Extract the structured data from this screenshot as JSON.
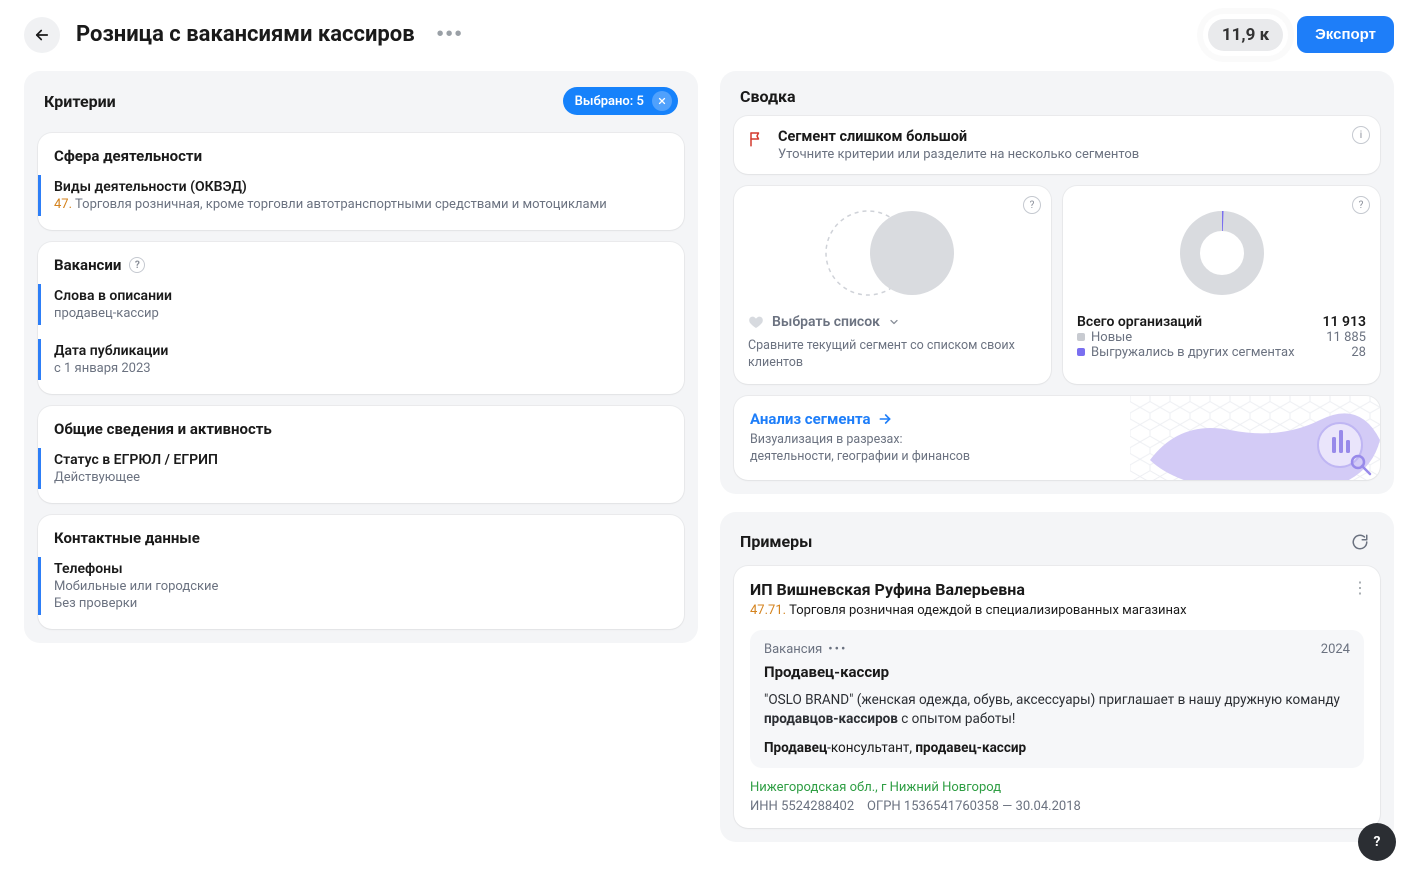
{
  "header": {
    "title": "Розница с вакансиями кассиров",
    "count_badge": "11,9 к",
    "export_label": "Экспорт"
  },
  "criteria": {
    "panel_title": "Критерии",
    "selected_chip": "Выбрано: 5",
    "groups": [
      {
        "title": "Сфера деятельности",
        "help": false,
        "items": [
          {
            "label": "Виды деятельности (ОКВЭД)",
            "code": "47.",
            "value": "Торговля розничная, кроме торговли автотранспортными средствами и мотоциклами"
          }
        ]
      },
      {
        "title": "Вакансии",
        "help": true,
        "items": [
          {
            "label": "Слова в описании",
            "value": "продавец-кассир"
          },
          {
            "label": "Дата публикации",
            "value": "с 1 января 2023"
          }
        ]
      },
      {
        "title": "Общие сведения и активность",
        "help": false,
        "items": [
          {
            "label": "Статус в ЕГРЮЛ / ЕГРИП",
            "value": "Действующее"
          }
        ]
      },
      {
        "title": "Контактные данные",
        "help": false,
        "items": [
          {
            "label": "Телефоны",
            "value": "Мобильные или городские",
            "value2": "Без проверки"
          }
        ]
      }
    ]
  },
  "summary": {
    "panel_title": "Сводка",
    "alert": {
      "title": "Сегмент слишком большой",
      "sub": "Уточните критерии или разделите на несколько сегментов"
    },
    "compare": {
      "select_label": "Выбрать список",
      "sub": "Сравните текущий сегмент со списком своих клиентов"
    },
    "stats": {
      "total_label": "Всего организаций",
      "total": "11 913",
      "rows": [
        {
          "label": "Новые",
          "value": "11 885",
          "color": "#c8cbd1"
        },
        {
          "label": "Выгружались в других сегментах",
          "value": "28",
          "color": "#7a6ff0"
        }
      ]
    },
    "analysis": {
      "link": "Анализ сегмента",
      "line1": "Визуализация в разрезах:",
      "line2": "деятельности, географии и финансов"
    }
  },
  "examples": {
    "panel_title": "Примеры",
    "items": [
      {
        "name": "ИП Вишневская Руфина Валерьевна",
        "okved_code": "47.71.",
        "okved_text": "Торговля розничная одеждой в специализированных магазинах",
        "vacancy": {
          "tag": "Вакансия",
          "year": "2024",
          "title": "Продавец-кассир",
          "body_prefix": "\"OSLO BRAND\" (женская одежда, обувь, аксессуары) приглашает в нашу дружную команду ",
          "body_bold": "продавцов-кассиров",
          "body_suffix": " с опытом работы!",
          "tags_bold1": "Продавец",
          "tags_plain": "-консультант, ",
          "tags_bold2": "продавец-кассир"
        },
        "location": "Нижегородская обл., г Нижний Новгород",
        "inn_label": "ИНН",
        "inn": "5524288402",
        "ogrn_label": "ОГРН",
        "ogrn": "1536541760358",
        "ogrn_date": "30.04.2018"
      }
    ]
  },
  "chart_data": {
    "type": "pie",
    "title": "Всего организаций",
    "series": [
      {
        "name": "Новые",
        "value": 11885
      },
      {
        "name": "Выгружались в других сегментах",
        "value": 28
      }
    ],
    "total": 11913
  }
}
